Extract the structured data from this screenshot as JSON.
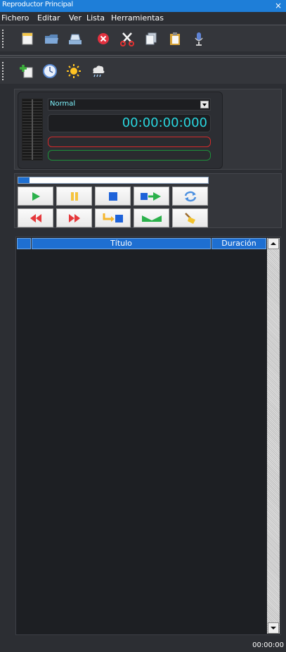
{
  "window": {
    "title": "Reproductor Principal",
    "close_glyph": "×"
  },
  "menu": [
    "Fichero",
    "Editar",
    "Ver",
    "Lista",
    "Herramientas"
  ],
  "toolbar1": [
    "new-document-icon",
    "open-folder-icon",
    "open-tray-icon",
    "stop-delete-icon",
    "cut-icon",
    "copy-icon",
    "paste-icon",
    "microphone-icon"
  ],
  "toolbar2": [
    "add-item-icon",
    "clock-icon",
    "sun-icon",
    "weather-icon"
  ],
  "player": {
    "mode": "Normal",
    "time": "00:00:00:000",
    "progress": 0.06
  },
  "transport_row1": [
    "play-icon",
    "pause-icon",
    "stop-icon",
    "next-track-icon",
    "loop-icon"
  ],
  "transport_row2": [
    "rewind-icon",
    "fast-forward-icon",
    "insert-icon",
    "crossfade-icon",
    "clear-icon"
  ],
  "playlist": {
    "columns": [
      "",
      "Título",
      "Duración"
    ]
  },
  "status": {
    "total_time": "00:00:00"
  },
  "colors": {
    "accent": "#1e7ed8",
    "time": "#29d6df",
    "red": "#d42b2b",
    "green": "#1e8f3a"
  }
}
